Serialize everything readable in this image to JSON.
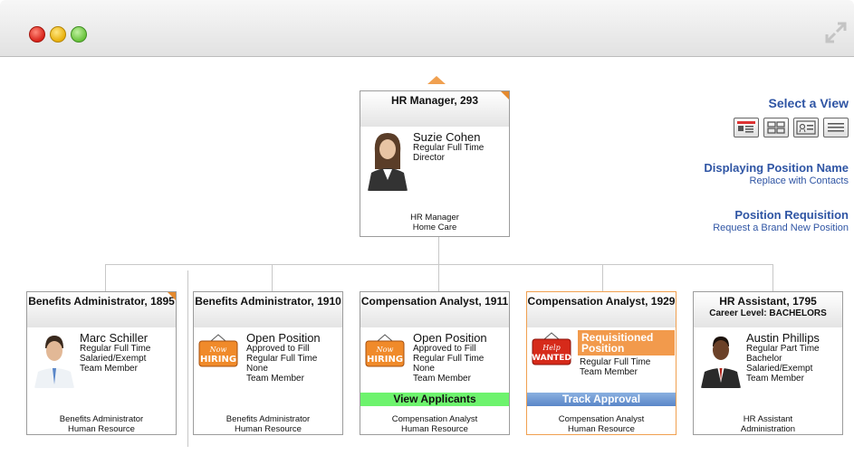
{
  "window": {
    "controls": [
      "close",
      "minimize",
      "zoom"
    ],
    "expand_icon": "expand-icon"
  },
  "top_card": {
    "title": "HR Manager, 293",
    "name": "Suzie Cohen",
    "line1": "Regular Full Time",
    "line2": "Director",
    "foot1": "HR Manager",
    "foot2": "Home Care"
  },
  "side_panel": {
    "select_view": "Select a View",
    "display_title": "Displaying Position Name",
    "display_sub": "Replace with Contacts",
    "req_title": "Position Requisition",
    "req_sub": "Request a Brand New Position"
  },
  "cards": [
    {
      "title": "Benefits Administrator, 1895",
      "name": "Marc Schiller",
      "lines": [
        "Regular Full Time",
        "Salaried/Exempt",
        "Team Member"
      ],
      "foot1": "Benefits Administrator",
      "foot2": "Human Resource"
    },
    {
      "title": "Benefits Administrator, 1910",
      "name": "Open Position",
      "lines": [
        "Approved to Fill",
        "Regular Full Time",
        "None",
        "Team Member"
      ],
      "foot1": "Benefits Administrator",
      "foot2": "Human Resource",
      "sign": "Now HIRING"
    },
    {
      "title": "Compensation Analyst, 1911",
      "name": "Open Position",
      "lines": [
        "Approved to Fill",
        "Regular Full Time",
        "None",
        "Team Member"
      ],
      "action": "View Applicants",
      "foot1": "Compensation Analyst",
      "foot2": "Human Resource",
      "sign": "Now HIRING"
    },
    {
      "title": "Compensation Analyst, 1929",
      "name": "Requisitioned Position",
      "lines": [
        "Regular Full Time",
        "Team Member"
      ],
      "action": "Track Approval",
      "foot1": "Compensation Analyst",
      "foot2": "Human Resource",
      "sign": "Help WANTED"
    },
    {
      "title": "HR Assistant, 1795",
      "subtitle": "Career Level: BACHELORS",
      "name": "Austin Phillips",
      "lines": [
        "Regular Part Time",
        "Bachelor",
        "Salaried/Exempt",
        "Team Member"
      ],
      "foot1": "HR Assistant",
      "foot2": "Administration"
    }
  ],
  "colors": {
    "accent_orange": "#f0a050",
    "link_blue": "#2f55a4",
    "view_applicants_green": "#6df36d"
  }
}
